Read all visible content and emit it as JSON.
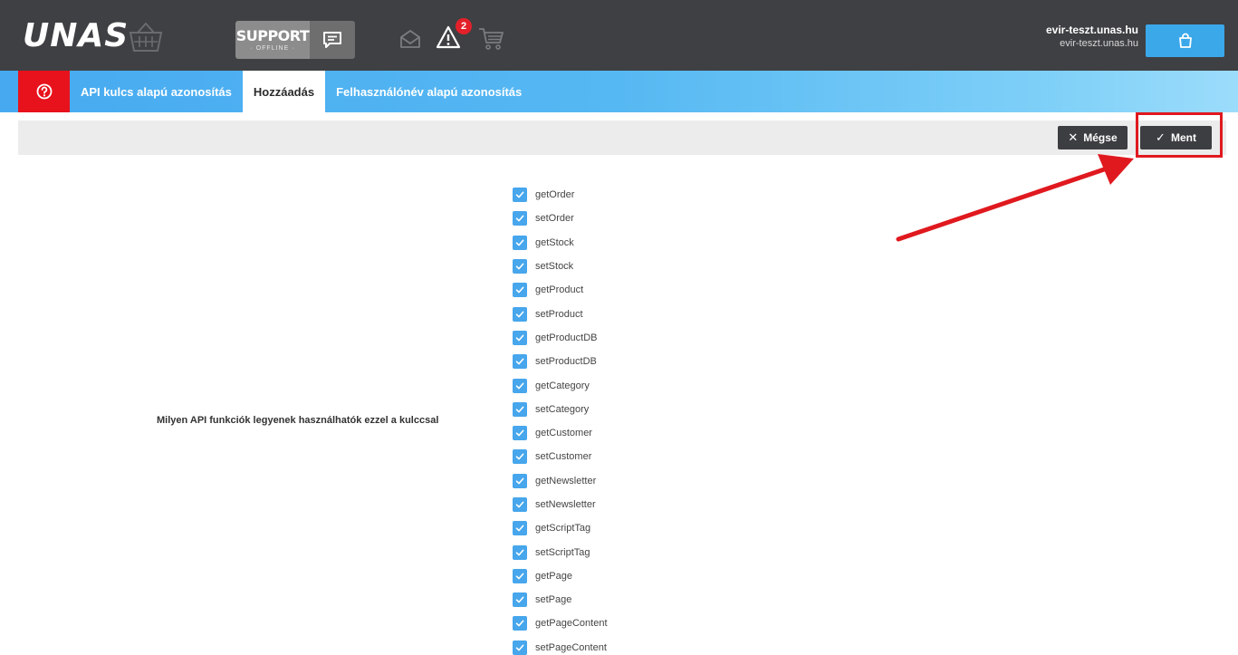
{
  "header": {
    "logo_text": "UNAS",
    "support_title": "SUPPORT",
    "support_status": "· OFFLINE ·",
    "notification_count": "2",
    "account_primary": "evir-teszt.unas.hu",
    "account_secondary": "evir-teszt.unas.hu"
  },
  "tabs": [
    {
      "label": "API kulcs alapú azonosítás",
      "active": false
    },
    {
      "label": "Hozzáadás",
      "active": true
    },
    {
      "label": "Felhasználónév alapú azonosítás",
      "active": false
    }
  ],
  "actions": {
    "cancel_label": "Mégse",
    "cancel_glyph": "✕",
    "save_label": "Ment",
    "save_glyph": "✓"
  },
  "form": {
    "functions_label": "Milyen API funkciók legyenek használhatók ezzel a kulccsal",
    "functions": [
      {
        "label": "getOrder",
        "checked": true
      },
      {
        "label": "setOrder",
        "checked": true
      },
      {
        "label": "getStock",
        "checked": true
      },
      {
        "label": "setStock",
        "checked": true
      },
      {
        "label": "getProduct",
        "checked": true
      },
      {
        "label": "setProduct",
        "checked": true
      },
      {
        "label": "getProductDB",
        "checked": true
      },
      {
        "label": "setProductDB",
        "checked": true
      },
      {
        "label": "getCategory",
        "checked": true
      },
      {
        "label": "setCategory",
        "checked": true
      },
      {
        "label": "getCustomer",
        "checked": true
      },
      {
        "label": "setCustomer",
        "checked": true
      },
      {
        "label": "getNewsletter",
        "checked": true
      },
      {
        "label": "setNewsletter",
        "checked": true
      },
      {
        "label": "getScriptTag",
        "checked": true
      },
      {
        "label": "setScriptTag",
        "checked": true
      },
      {
        "label": "getPage",
        "checked": true
      },
      {
        "label": "setPage",
        "checked": true
      },
      {
        "label": "getPageContent",
        "checked": true
      },
      {
        "label": "setPageContent",
        "checked": true
      }
    ]
  },
  "colors": {
    "header_bg": "#3f4043",
    "accent_blue": "#47a6ec",
    "help_red": "#e8121c",
    "annotation_red": "#e0191f",
    "button_dark": "#3d3e41"
  },
  "icons": {
    "basket": "basket-icon",
    "chat": "chat-icon",
    "mail": "mail-icon",
    "warning": "warning-icon",
    "cart": "cart-icon",
    "shop": "shopping-bag-icon",
    "help": "help-icon",
    "checkbox": "check-icon"
  }
}
